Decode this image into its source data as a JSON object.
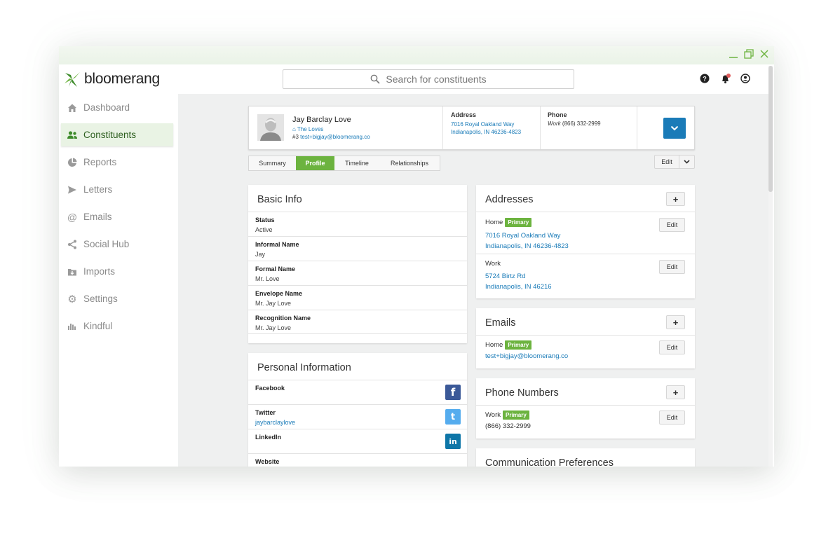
{
  "brand": {
    "name": "bloomerang",
    "accent": "#6cb33f",
    "link": "#1a7bb8"
  },
  "window_controls": {
    "minimize": "minimize-icon",
    "restore": "restore-icon",
    "close": "close-icon"
  },
  "search": {
    "placeholder": "Search for constituents"
  },
  "header_icons": [
    "help-icon",
    "bell-icon",
    "user-icon"
  ],
  "sidebar": {
    "items": [
      {
        "label": "Dashboard",
        "icon": "home-icon"
      },
      {
        "label": "Constituents",
        "icon": "people-icon",
        "active": true
      },
      {
        "label": "Reports",
        "icon": "pie-chart-icon"
      },
      {
        "label": "Letters",
        "icon": "send-icon"
      },
      {
        "label": "Emails",
        "icon": "at-icon"
      },
      {
        "label": "Social Hub",
        "icon": "share-icon"
      },
      {
        "label": "Imports",
        "icon": "import-icon"
      },
      {
        "label": "Settings",
        "icon": "gear-icon"
      },
      {
        "label": "Kindful",
        "icon": "bars-icon"
      }
    ]
  },
  "constituent": {
    "name": "Jay Barclay Love",
    "household": "The Loves",
    "id_prefix": "#3",
    "email": "test+bigjay@bloomerang.co",
    "address_label": "Address",
    "address_line1": "7016 Royal Oakland Way",
    "address_line2": "Indianapolis, IN 46236-4823",
    "phone_label": "Phone",
    "phone_type": "Work",
    "phone": "(866) 332-2999"
  },
  "tabs": [
    "Summary",
    "Profile",
    "Timeline",
    "Relationships"
  ],
  "active_tab": "Profile",
  "edit_label": "Edit",
  "basic_info": {
    "title": "Basic Info",
    "fields": [
      {
        "label": "Status",
        "value": "Active"
      },
      {
        "label": "Informal Name",
        "value": "Jay"
      },
      {
        "label": "Formal Name",
        "value": "Mr. Love"
      },
      {
        "label": "Envelope Name",
        "value": "Mr. Jay Love"
      },
      {
        "label": "Recognition Name",
        "value": "Mr. Jay Love"
      }
    ]
  },
  "personal_info": {
    "title": "Personal Information",
    "fields": [
      {
        "label": "Facebook",
        "value": "",
        "icon": "facebook-icon"
      },
      {
        "label": "Twitter",
        "value": "jaybarclaylove",
        "icon": "twitter-icon"
      },
      {
        "label": "LinkedIn",
        "value": "",
        "icon": "linkedin-icon"
      },
      {
        "label": "Website",
        "value": ""
      }
    ]
  },
  "addresses": {
    "title": "Addresses",
    "add": "+",
    "items": [
      {
        "type": "Home",
        "primary": "Primary",
        "line1": "7016 Royal Oakland Way",
        "line2": "Indianapolis, IN 46236-4823",
        "edit": "Edit"
      },
      {
        "type": "Work",
        "primary": "",
        "line1": "5724 Birtz Rd",
        "line2": "Indianapolis, IN 46216",
        "edit": "Edit"
      }
    ]
  },
  "emails": {
    "title": "Emails",
    "add": "+",
    "items": [
      {
        "type": "Home",
        "primary": "Primary",
        "value": "test+bigjay@bloomerang.co",
        "edit": "Edit"
      }
    ]
  },
  "phones": {
    "title": "Phone Numbers",
    "add": "+",
    "items": [
      {
        "type": "Work",
        "primary": "Primary",
        "value": "(866) 332-2999",
        "edit": "Edit"
      }
    ]
  },
  "communication": {
    "title": "Communication Preferences"
  }
}
